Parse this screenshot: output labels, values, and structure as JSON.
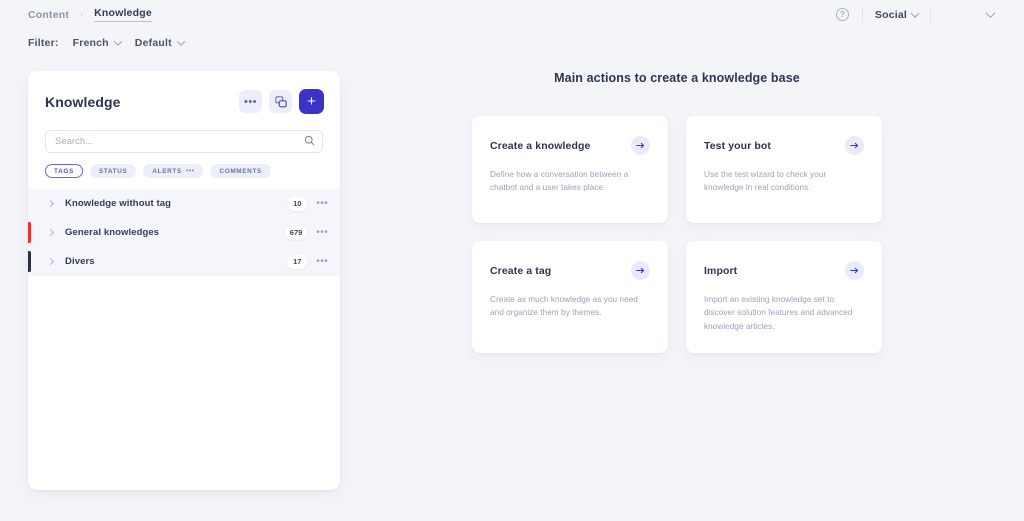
{
  "topbar": {
    "breadcrumb": {
      "parent": "Content",
      "separator": "›",
      "current": "Knowledge"
    },
    "help_icon": "help-circle-icon",
    "workspace": {
      "label": "Social",
      "chevron": "chevron-down-icon"
    },
    "account_chevron": "chevron-down-icon"
  },
  "filterbar": {
    "label": "Filter:",
    "language": {
      "value": "French",
      "chevron": "chevron-down-icon"
    },
    "preset": {
      "value": "Default",
      "chevron": "chevron-down-icon"
    }
  },
  "panel": {
    "title": "Knowledge",
    "actions": {
      "more_label": "•••",
      "more_icon": "ellipsis-icon",
      "duplicate_icon": "copy-icon",
      "add_label": "+",
      "add_icon": "plus-icon"
    },
    "search": {
      "placeholder": "Search...",
      "value": "",
      "icon": "search-icon"
    },
    "chips": [
      {
        "label": "TAGS",
        "active": true,
        "has_more": false
      },
      {
        "label": "STATUS",
        "active": false,
        "has_more": false
      },
      {
        "label": "ALERTS",
        "active": false,
        "has_more": true,
        "more": "•••"
      },
      {
        "label": "COMMENTS",
        "active": false,
        "has_more": false
      }
    ],
    "rows": [
      {
        "label": "Knowledge without tag",
        "count": "10",
        "color": "",
        "more": "•••"
      },
      {
        "label": "General knowledges",
        "count": "679",
        "color": "#f0312b",
        "more": "•••"
      },
      {
        "label": "Divers",
        "count": "17",
        "color": "#2b3043",
        "more": "•••"
      }
    ]
  },
  "main": {
    "title": "Main actions to create a knowledge base",
    "cards": [
      {
        "title": "Create a knowledge",
        "description": "Define how a conversation between a chatbot and a user takes place.",
        "arrow_icon": "arrow-right-icon"
      },
      {
        "title": "Test your bot",
        "description": "Use the test wizard to check your knowledge in real conditions.",
        "arrow_icon": "arrow-right-icon"
      },
      {
        "title": "Create a tag",
        "description": "Create as much knowledge as you need and organize them by themes.",
        "arrow_icon": "arrow-right-icon"
      },
      {
        "title": "Import",
        "description": "Import an existing knowledge set to discover solution features and advanced knowledge articles.",
        "arrow_icon": "arrow-right-icon"
      }
    ]
  },
  "colors": {
    "accent": "#3b32c8",
    "chip_active": "#5a53d6",
    "page_bg": "#f4f5f9",
    "list_bg": "#f5f6fb",
    "text_dark": "#2e3450",
    "text_muted": "#9ba2b8"
  }
}
